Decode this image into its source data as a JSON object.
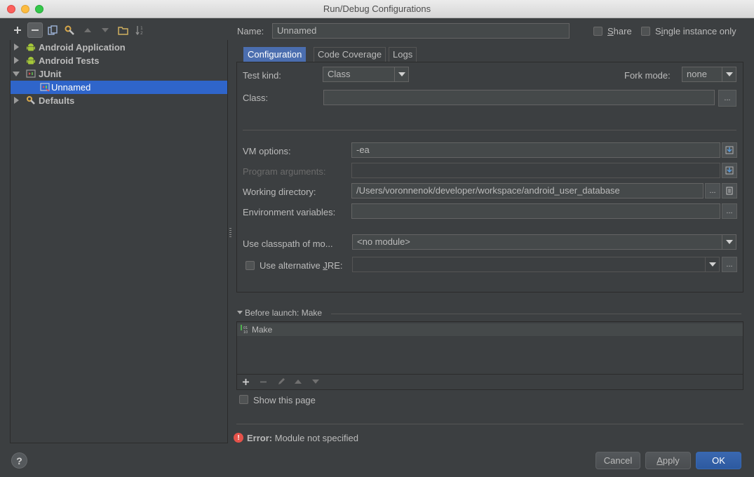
{
  "window": {
    "title": "Run/Debug Configurations"
  },
  "left_toolbar": {
    "buttons": [
      "add-icon",
      "remove-icon",
      "copy-icon",
      "wrench-icon",
      "move-up-icon",
      "move-down-icon",
      "folder-icon",
      "sort-icon"
    ]
  },
  "tree": {
    "items": [
      {
        "label": "Android Application",
        "icon": "android-icon",
        "expanded": false
      },
      {
        "label": "Android Tests",
        "icon": "android-icon",
        "expanded": false
      },
      {
        "label": "JUnit",
        "icon": "junit-icon",
        "expanded": true
      },
      {
        "label": "Unnamed",
        "icon": "junit-config-icon",
        "selected": true
      },
      {
        "label": "Defaults",
        "icon": "wrench-icon",
        "expanded": false
      }
    ]
  },
  "name_row": {
    "label": "Name:",
    "value": "Unnamed",
    "share_label": "Share",
    "share_mnemonic": "S",
    "single_instance_label": "Single instance only",
    "single_instance_mnemonic": "i"
  },
  "tabs": [
    "Configuration",
    "Code Coverage",
    "Logs"
  ],
  "config": {
    "test_kind_label": "Test kind:",
    "test_kind_value": "Class",
    "fork_mode_label": "Fork mode:",
    "fork_mode_value": "none",
    "class_label": "Class:",
    "class_value": "",
    "vm_options_label": "VM options:",
    "vm_options_value": "-ea",
    "program_args_label": "Program arguments:",
    "program_args_value": "",
    "working_dir_label": "Working directory:",
    "working_dir_value": "/Users/voronnenok/developer/workspace/android_user_database",
    "env_vars_label": "Environment variables:",
    "env_vars_value": "",
    "classpath_label": "Use classpath of mo...",
    "classpath_value": "<no module>",
    "alt_jre_label": "Use alternative JRE:",
    "alt_jre_mnemonic": "J",
    "ellipsis": "..."
  },
  "before_launch": {
    "header": "Before launch: Make",
    "items": [
      "Make"
    ],
    "show_this_page": "Show this page"
  },
  "error": {
    "prefix": "Error:",
    "message": "Module not specified"
  },
  "buttons": {
    "help": "?",
    "cancel": "Cancel",
    "apply": "Apply",
    "ok": "OK"
  },
  "colors": {
    "accent": "#2f65ca",
    "tab_active": "#4b6eaf",
    "error": "#e5524a"
  }
}
